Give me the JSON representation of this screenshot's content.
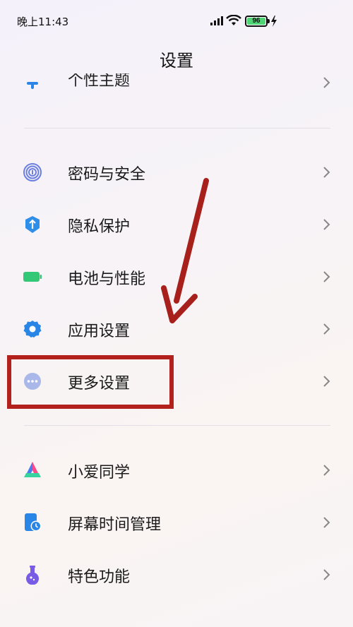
{
  "status": {
    "time": "晚上11:43",
    "battery": "96"
  },
  "page_title": "设置",
  "partial_item": {
    "label": "个性主题"
  },
  "groups": [
    {
      "items": [
        {
          "label": "密码与安全",
          "icon": "fingerprint-icon",
          "color": "#6a7fe0"
        },
        {
          "label": "隐私保护",
          "icon": "shield-icon",
          "color": "#2f8ee8"
        },
        {
          "label": "电池与性能",
          "icon": "battery-icon",
          "color": "#34c776"
        },
        {
          "label": "应用设置",
          "icon": "gear-icon",
          "color": "#2a86e6"
        },
        {
          "label": "更多设置",
          "icon": "more-dots-icon",
          "color": "#a9b8e8"
        }
      ]
    },
    {
      "items": [
        {
          "label": "小爱同学",
          "icon": "xiaoai-icon",
          "color": "#4a7cf0"
        },
        {
          "label": "屏幕时间管理",
          "icon": "screen-time-icon",
          "color": "#2a86e6"
        },
        {
          "label": "特色功能",
          "icon": "flask-icon",
          "color": "#7a5be6"
        }
      ]
    }
  ],
  "annotation": {
    "highlight_color": "#b3211c"
  }
}
